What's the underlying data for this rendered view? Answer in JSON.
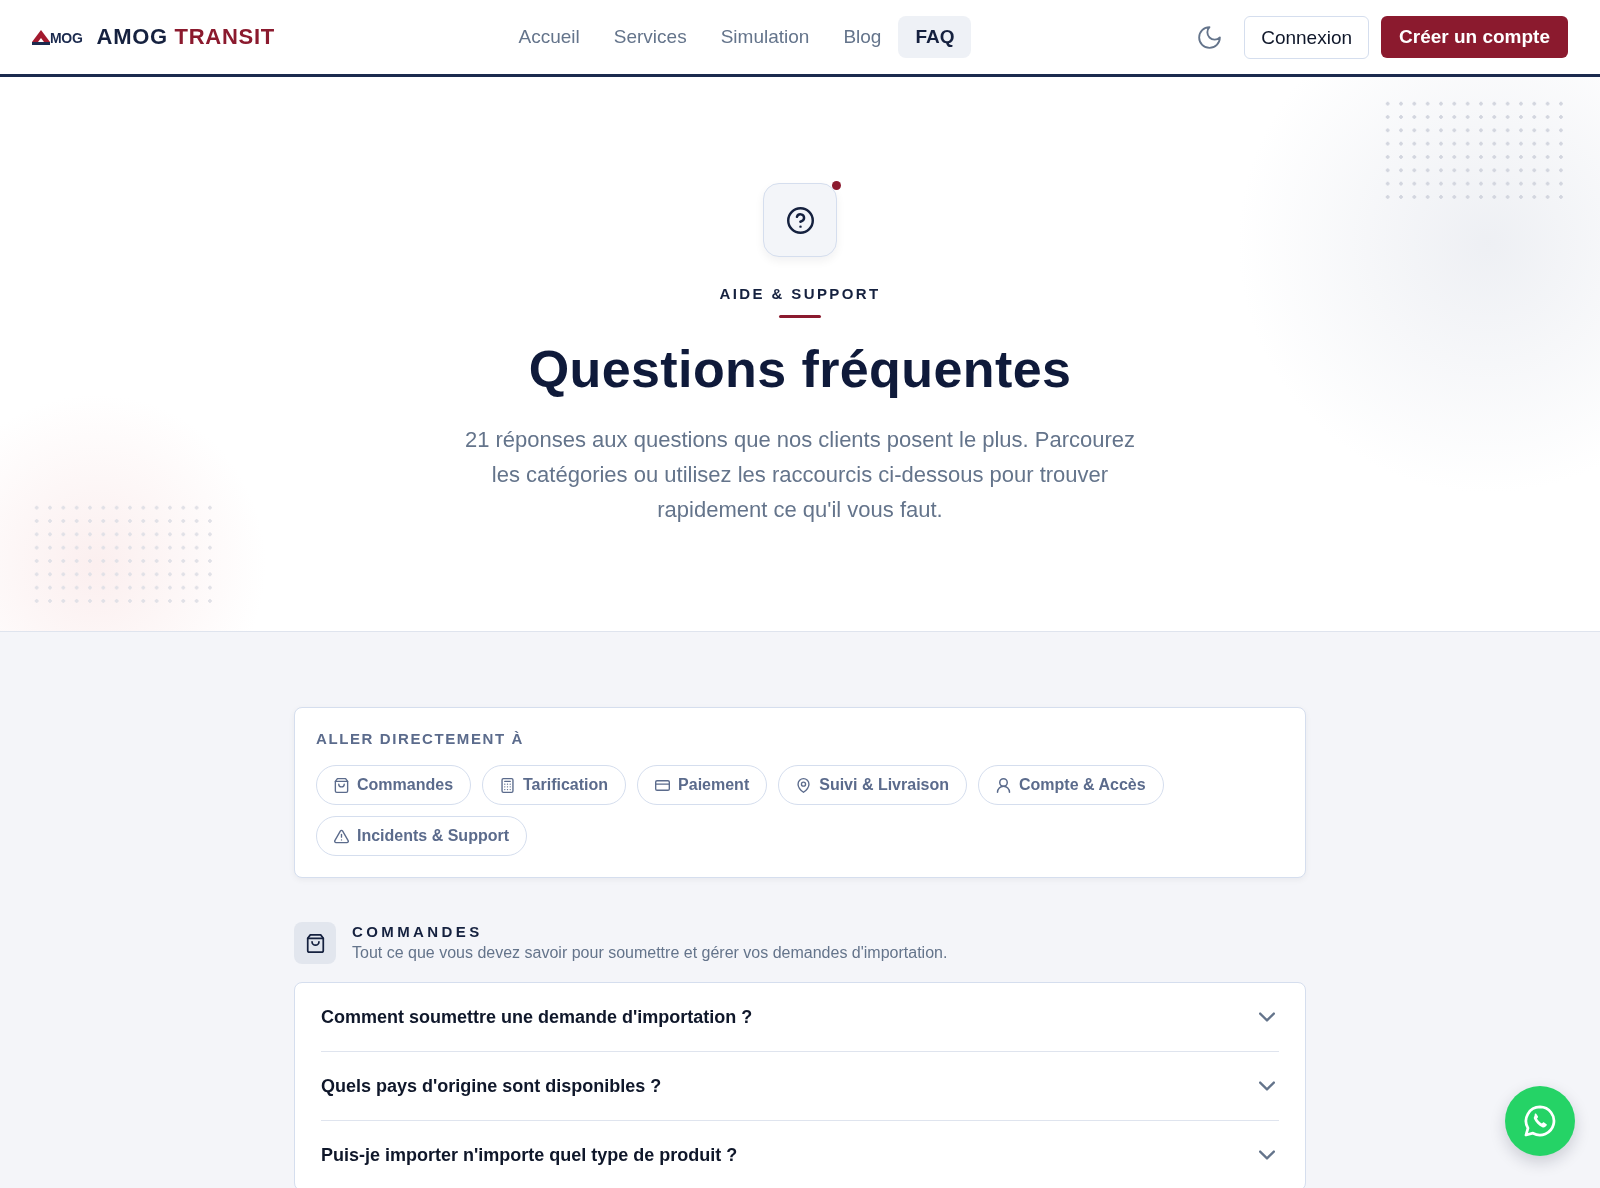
{
  "navbar": {
    "brand": {
      "mark_text": "MOG",
      "name_first": "AMOG",
      "name_second": "TRANSIT"
    },
    "links": [
      {
        "label": "Accueil",
        "selected": false
      },
      {
        "label": "Services",
        "selected": false
      },
      {
        "label": "Simulation",
        "selected": false
      },
      {
        "label": "Blog",
        "selected": false
      },
      {
        "label": "FAQ",
        "selected": true
      }
    ],
    "buttons": [
      {
        "label": "Connexion",
        "kind": "outline"
      },
      {
        "label": "Créer un compte",
        "kind": "primary"
      }
    ]
  },
  "hero": {
    "eyebrow": "AIDE & SUPPORT",
    "title": "Questions fréquentes",
    "lead": "21 réponses aux questions que nos clients posent le plus. Parcourez les catégories ou utilisez les raccourcis ci-dessous pour trouver rapidement ce qu'il vous faut."
  },
  "shortcuts": {
    "label": "ALLER DIRECTEMENT À",
    "chips": [
      "Commandes",
      "Tarification",
      "Paiement",
      "Suivi & Livraison",
      "Compte & Accès",
      "Incidents & Support"
    ]
  },
  "sections": [
    {
      "title": "COMMANDES",
      "description": "Tout ce que vous devez savoir pour soumettre et gérer vos demandes d'importation.",
      "questions": [
        {
          "question": "Comment soumettre une demande d'importation ?",
          "expanded": false
        },
        {
          "question": "Quels pays d'origine sont disponibles ?",
          "expanded": false
        },
        {
          "question": "Puis-je importer n'importe quel type de produit ?",
          "expanded": false
        }
      ]
    }
  ]
}
